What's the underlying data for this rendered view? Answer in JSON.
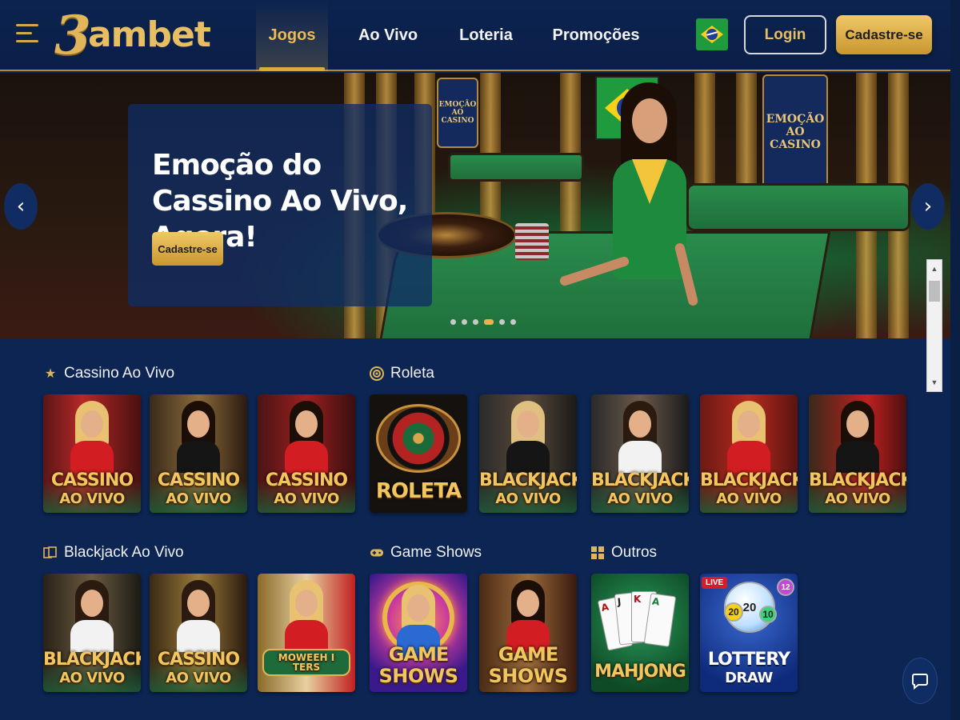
{
  "header": {
    "logo_text_number": "3",
    "logo_text_rest": "ambet",
    "nav": [
      {
        "label": "Jogos",
        "active": true
      },
      {
        "label": "Ao Vivo",
        "active": false
      },
      {
        "label": "Loteria",
        "active": false
      },
      {
        "label": "Promoções",
        "active": false
      }
    ],
    "login_label": "Login",
    "signup_label": "Cadastre-se",
    "accent_color": "#e8be62",
    "background_color": "#0c2350"
  },
  "hero": {
    "title": "Emoção do Cassino Ao Vivo, Agora!",
    "cta_label": "Cadastre-se",
    "sign_text": "EMOÇÃO AO CASINO",
    "sign_text_small": "EMOÇÃO AO CASINO",
    "slide_count": 6,
    "active_slide": 4
  },
  "sections": {
    "cassino": {
      "title": "Cassino Ao Vivo",
      "icon": "star-icon",
      "tiles": [
        {
          "l1": "CASSINO",
          "l2": "AO VIVO"
        },
        {
          "l1": "CASSINO",
          "l2": "AO VIVO"
        },
        {
          "l1": "CASSINO",
          "l2": "AO VIVO"
        }
      ]
    },
    "roleta": {
      "title": "Roleta",
      "icon": "roulette-icon",
      "tiles": [
        {
          "l1": "ROLETA",
          "l2": ""
        },
        {
          "l1": "BLACKJACK",
          "l2": "AO VIVO"
        },
        {
          "l1": "BLACKJACK",
          "l2": "AO VIVO"
        },
        {
          "l1": "BLACKJACK",
          "l2": "AO VIVO"
        },
        {
          "l1": "BLACKJACK",
          "l2": "AO VIVO"
        }
      ]
    },
    "blackjack": {
      "title": "Blackjack Ao Vivo",
      "icon": "cards-icon",
      "tiles": [
        {
          "l1": "BLACKJACK",
          "l2": "AO VIVO"
        },
        {
          "l1": "CASSINO",
          "l2": "AO VIVO"
        },
        {
          "l1": "MOWEEH I TERS",
          "l2": ""
        }
      ]
    },
    "gameshows": {
      "title": "Game Shows",
      "icon": "gamepad-icon",
      "tiles": [
        {
          "l1": "GAME",
          "l2": "SHOWS"
        },
        {
          "l1": "GAME",
          "l2": "SHOWS"
        }
      ]
    },
    "outros": {
      "title": "Outros",
      "icon": "grid-icon",
      "tiles": [
        {
          "l1": "MAHJONG",
          "l2": ""
        },
        {
          "l1": "LOTTERY",
          "l2": "DRAW",
          "badge": "LIVE",
          "ball_numbers": [
            "20",
            "20",
            "10",
            "12"
          ]
        }
      ]
    }
  },
  "mahjong_card_ranks": [
    "A",
    "J",
    "K",
    "A"
  ]
}
